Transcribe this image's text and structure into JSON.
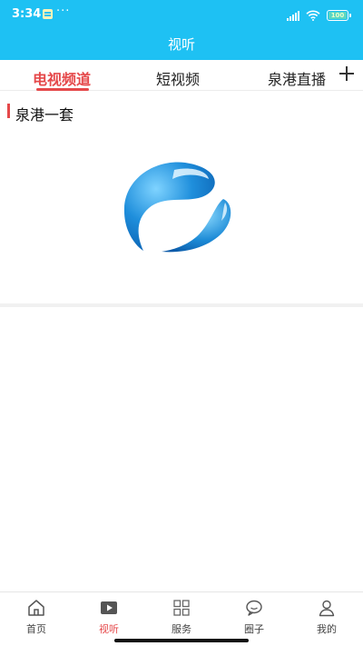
{
  "status_bar": {
    "time": "3:34",
    "dots": "···",
    "battery": "100"
  },
  "header": {
    "title": "视听"
  },
  "tabs": [
    {
      "label": "电视频道",
      "active": true
    },
    {
      "label": "短视频",
      "active": false
    },
    {
      "label": "泉港直播",
      "active": false
    }
  ],
  "channels": [
    {
      "title": "泉港一套",
      "logo": "quangang-tv-logo"
    }
  ],
  "bottom_nav": [
    {
      "label": "首页",
      "icon": "home-icon",
      "active": false
    },
    {
      "label": "视听",
      "icon": "play-icon",
      "active": true
    },
    {
      "label": "服务",
      "icon": "grid-icon",
      "active": false
    },
    {
      "label": "圈子",
      "icon": "chat-bubble-icon",
      "active": false
    },
    {
      "label": "我的",
      "icon": "person-icon",
      "active": false
    }
  ],
  "colors": {
    "header_bg": "#1ec1f3",
    "accent": "#e5484a"
  }
}
